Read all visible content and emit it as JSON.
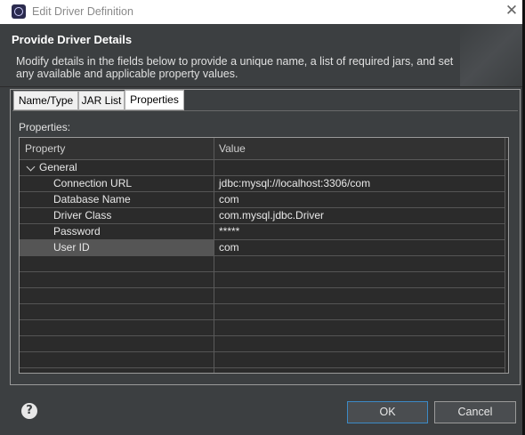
{
  "window": {
    "title": "Edit Driver Definition",
    "close_glyph": "✕"
  },
  "header": {
    "title": "Provide Driver Details",
    "description": "Modify details in the fields below to provide a unique name, a list of required jars, and set any available and applicable property values."
  },
  "tabs": [
    {
      "label": "Name/Type"
    },
    {
      "label": "JAR List"
    },
    {
      "label": "Properties",
      "active": true
    }
  ],
  "properties_label": "Properties:",
  "table": {
    "columns": [
      "Property",
      "Value"
    ],
    "group": "General",
    "rows": [
      {
        "property": "Connection URL",
        "value": "jdbc:mysql://localhost:3306/com"
      },
      {
        "property": "Database Name",
        "value": "com"
      },
      {
        "property": "Driver Class",
        "value": "com.mysql.jdbc.Driver"
      },
      {
        "property": "Password",
        "value": "*****"
      },
      {
        "property": "User ID",
        "value": "com",
        "selected": true
      }
    ]
  },
  "buttons": {
    "ok": "OK",
    "cancel": "Cancel",
    "help_glyph": "?"
  }
}
